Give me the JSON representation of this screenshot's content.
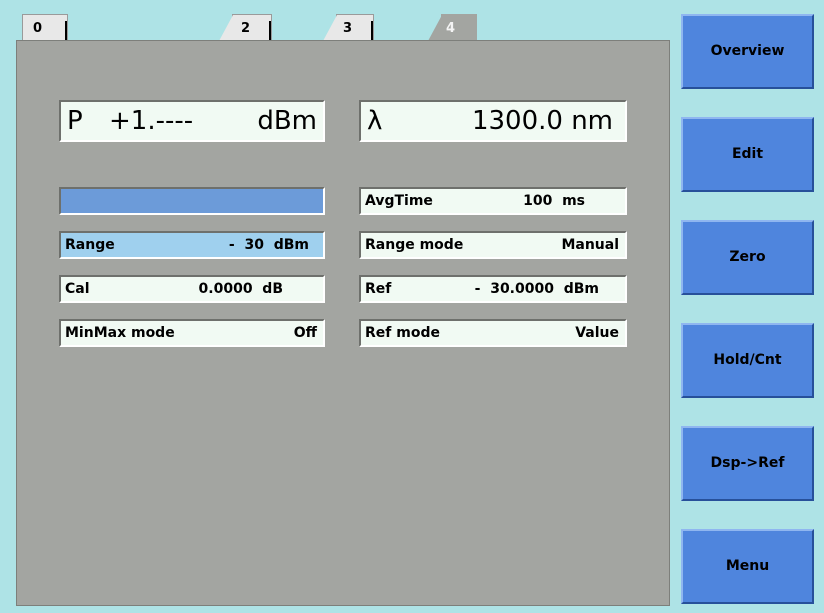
{
  "tabs": [
    {
      "label": "0",
      "active": false
    },
    {
      "label": "2",
      "active": false
    },
    {
      "label": "3",
      "active": false
    },
    {
      "label": "4",
      "active": true
    }
  ],
  "power_display": {
    "symbol": "P",
    "value": "+1.----",
    "unit": "dBm"
  },
  "wavelength_display": {
    "symbol": "λ",
    "value": "1300.0 nm"
  },
  "left_fields": {
    "range": {
      "label": "Range",
      "value": "-  30  dBm"
    },
    "cal": {
      "label": "Cal",
      "value": "0.0000  dB"
    },
    "minmax": {
      "label": "MinMax mode",
      "value": "Off"
    }
  },
  "right_fields": {
    "avgtime": {
      "label": "AvgTime",
      "value": "100  ms"
    },
    "range_mode": {
      "label": "Range mode",
      "value": "Manual"
    },
    "ref": {
      "label": "Ref",
      "value": "-  30.0000  dBm"
    },
    "ref_mode": {
      "label": "Ref mode",
      "value": "Value"
    }
  },
  "softkeys": [
    "Overview",
    "Edit",
    "Zero",
    "Hold/Cnt",
    "Dsp->Ref",
    "Menu"
  ]
}
